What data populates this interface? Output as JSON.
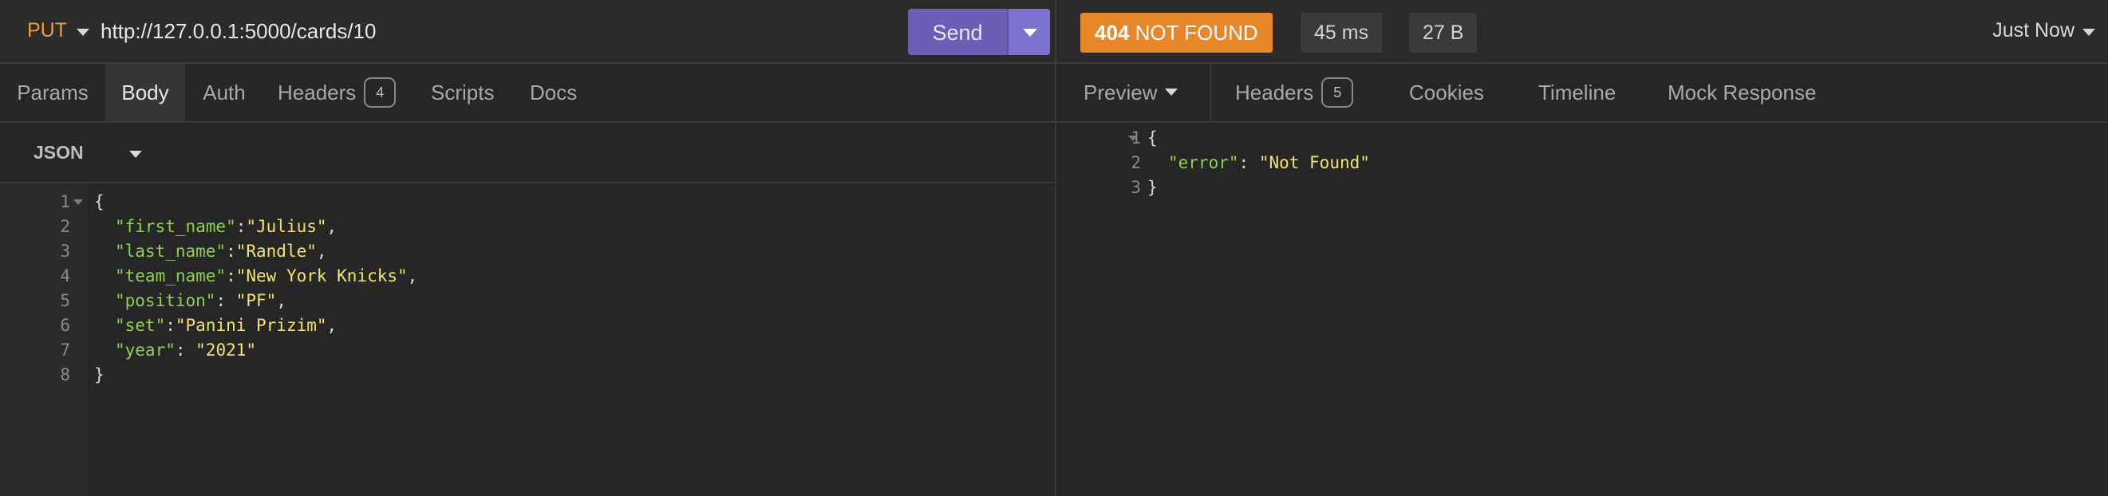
{
  "request": {
    "method": "PUT",
    "url": "http://127.0.0.1:5000/cards/10",
    "send_label": "Send",
    "tabs": [
      {
        "label": "Params"
      },
      {
        "label": "Body"
      },
      {
        "label": "Auth"
      },
      {
        "label": "Headers",
        "count": "4"
      },
      {
        "label": "Scripts"
      },
      {
        "label": "Docs"
      }
    ],
    "active_tab": "Body",
    "body_type": "JSON",
    "lines": [
      {
        "n": "1",
        "text": "{"
      },
      {
        "n": "2",
        "key": "\"first_name\"",
        "sep": ":",
        "val": "\"Julius\"",
        "end": ","
      },
      {
        "n": "3",
        "key": "\"last_name\"",
        "sep": ":",
        "val": "\"Randle\"",
        "end": ","
      },
      {
        "n": "4",
        "key": "\"team_name\"",
        "sep": ":",
        "val": "\"New York Knicks\"",
        "end": ","
      },
      {
        "n": "5",
        "key": "\"position\"",
        "sep": ": ",
        "val": "\"PF\"",
        "end": ","
      },
      {
        "n": "6",
        "key": "\"set\"",
        "sep": ":",
        "val": "\"Panini Prizim\"",
        "end": ","
      },
      {
        "n": "7",
        "key": "\"year\"",
        "sep": ": ",
        "val": "\"2021\"",
        "end": ""
      },
      {
        "n": "8",
        "text": "}"
      }
    ]
  },
  "response": {
    "status_code": "404",
    "status_text": "NOT FOUND",
    "status_color": "#e8872a",
    "time": "45 ms",
    "size": "27 B",
    "timestamp": "Just Now",
    "tabs": [
      {
        "label": "Preview"
      },
      {
        "label": "Headers",
        "count": "5"
      },
      {
        "label": "Cookies"
      },
      {
        "label": "Timeline"
      },
      {
        "label": "Mock Response"
      }
    ],
    "lines": [
      {
        "n": "1",
        "text": "{"
      },
      {
        "n": "2",
        "key": "\"error\"",
        "sep": ": ",
        "val": "\"Not Found\"",
        "end": ""
      },
      {
        "n": "3",
        "text": "}"
      }
    ]
  },
  "colors": {
    "accent": "#6b5fb5",
    "method": "#f39a2c",
    "json_key": "#8fd14f",
    "json_string": "#f3e36b"
  },
  "icons": [
    "chevron-down-icon",
    "fold-arrow-icon"
  ]
}
